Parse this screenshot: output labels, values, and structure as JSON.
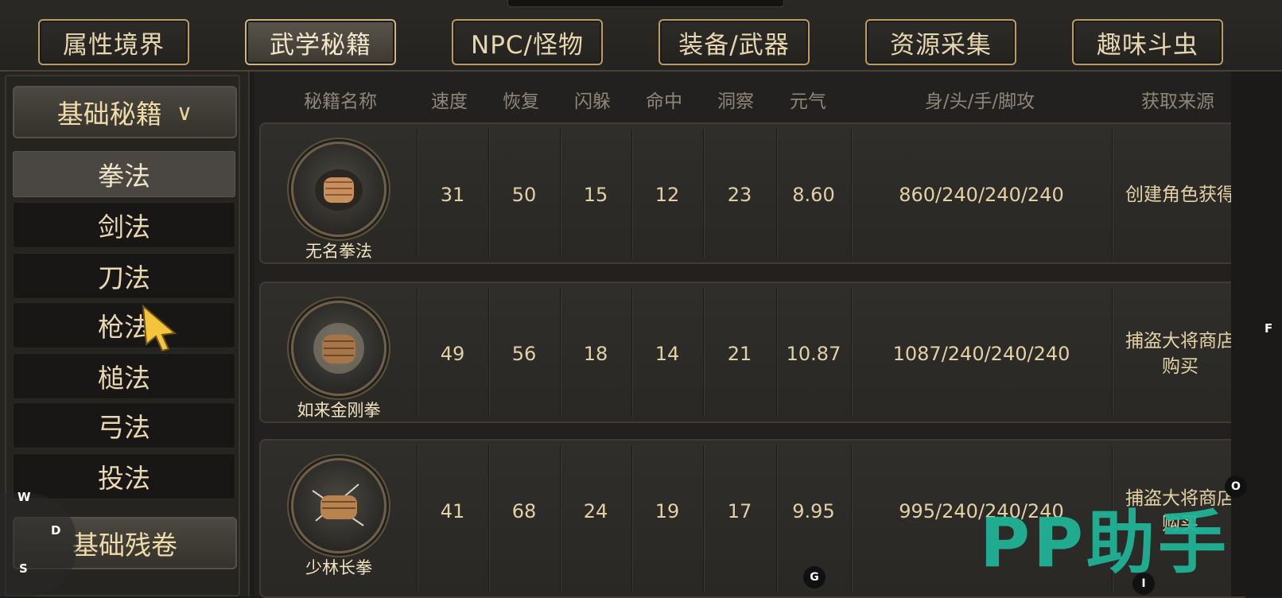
{
  "tabs": [
    {
      "label": "属性境界",
      "active": false
    },
    {
      "label": "武学秘籍",
      "active": true
    },
    {
      "label": "NPC/怪物",
      "active": false
    },
    {
      "label": "装备/武器",
      "active": false
    },
    {
      "label": "资源采集",
      "active": false
    },
    {
      "label": "趣味斗虫",
      "active": false
    }
  ],
  "sidebar": {
    "category_label": "基础秘籍",
    "category_chevron": "chevron-down-icon",
    "items": [
      {
        "label": "拳法",
        "active": true
      },
      {
        "label": "剑法",
        "active": false
      },
      {
        "label": "刀法",
        "active": false
      },
      {
        "label": "枪法",
        "active": false
      },
      {
        "label": "槌法",
        "active": false
      },
      {
        "label": "弓法",
        "active": false
      },
      {
        "label": "投法",
        "active": false
      }
    ],
    "second_category_label": "基础残卷"
  },
  "table": {
    "headers": [
      "秘籍名称",
      "速度",
      "恢复",
      "闪躲",
      "命中",
      "洞察",
      "元气",
      "身/头/手/脚攻",
      "获取来源"
    ],
    "rows": [
      {
        "name": "无名拳法",
        "speed": "31",
        "recovery": "50",
        "dodge": "15",
        "hit": "12",
        "insight": "23",
        "vitality": "8.60",
        "attack": "860/240/240/240",
        "source_lines": [
          "创建角色获得"
        ]
      },
      {
        "name": "如来金刚拳",
        "speed": "49",
        "recovery": "56",
        "dodge": "18",
        "hit": "14",
        "insight": "21",
        "vitality": "10.87",
        "attack": "1087/240/240/240",
        "source_lines": [
          "捕盗大将商店",
          "购买"
        ]
      },
      {
        "name": "少林长拳",
        "speed": "41",
        "recovery": "68",
        "dodge": "24",
        "hit": "19",
        "insight": "17",
        "vitality": "9.95",
        "attack": "995/240/240/240",
        "source_lines": [
          "捕盗大将商店",
          "购买"
        ]
      }
    ]
  },
  "key_hints": {
    "w": "W",
    "d": "D",
    "s": "S",
    "f": "F",
    "o": "O",
    "g": "G",
    "i": "I"
  },
  "watermark": "PP助手",
  "colors": {
    "accent_gold": "#b89c63",
    "watermark_teal": "#1fb79a",
    "text_light": "#e3d1a6"
  }
}
